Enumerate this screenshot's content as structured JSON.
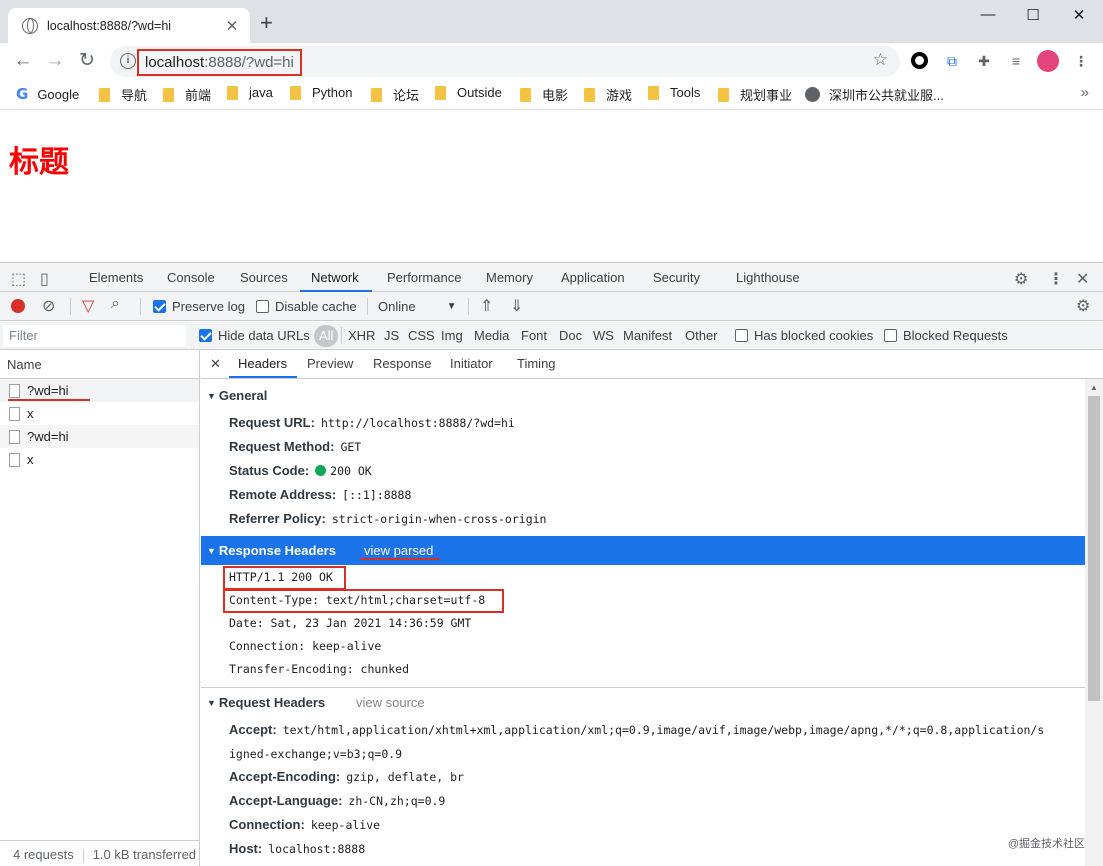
{
  "browser": {
    "tab_title": "localhost:8888/?wd=hi",
    "tab_close": "✕",
    "new_tab": "+",
    "window_controls": {
      "minimize": "—",
      "maximize": "☐",
      "close": "✕"
    },
    "nav": {
      "back": "←",
      "forward": "→",
      "reload": "↻"
    },
    "url_host": "localhost",
    "url_rest": ":8888/?wd=hi",
    "star_icon": "☆",
    "bookmarks": [
      {
        "label": "Google",
        "icon": "google-icon"
      },
      {
        "label": "导航",
        "icon": "folder-icon"
      },
      {
        "label": "前端",
        "icon": "folder-icon"
      },
      {
        "label": "java",
        "icon": "folder-icon"
      },
      {
        "label": "Python",
        "icon": "folder-icon"
      },
      {
        "label": "论坛",
        "icon": "folder-icon"
      },
      {
        "label": "Outside",
        "icon": "folder-icon"
      },
      {
        "label": "电影",
        "icon": "folder-icon"
      },
      {
        "label": "游戏",
        "icon": "folder-icon"
      },
      {
        "label": "Tools",
        "icon": "folder-icon"
      },
      {
        "label": "规划事业",
        "icon": "folder-icon"
      },
      {
        "label": "深圳市公共就业服...",
        "icon": "globe-icon"
      }
    ],
    "bookmarks_more": "»"
  },
  "page": {
    "heading": "标题"
  },
  "devtools": {
    "tabs": [
      "Elements",
      "Console",
      "Sources",
      "Network",
      "Performance",
      "Memory",
      "Application",
      "Security",
      "Lighthouse"
    ],
    "active_tab": "Network",
    "toolbar": {
      "preserve_log": "Preserve log",
      "disable_cache": "Disable cache",
      "throttle": "Online"
    },
    "filter": {
      "placeholder": "Filter",
      "hide_data_urls": "Hide data URLs",
      "all": "All",
      "types": [
        "XHR",
        "JS",
        "CSS",
        "Img",
        "Media",
        "Font",
        "Doc",
        "WS",
        "Manifest",
        "Other"
      ],
      "has_blocked_cookies": "Has blocked cookies",
      "blocked_requests": "Blocked Requests"
    },
    "requests": {
      "header": "Name",
      "rows": [
        "?wd=hi",
        "x",
        "?wd=hi",
        "x"
      ],
      "status_count": "4 requests",
      "status_transferred": "1.0 kB transferred"
    },
    "details": {
      "close": "✕",
      "tabs": [
        "Headers",
        "Preview",
        "Response",
        "Initiator",
        "Timing"
      ],
      "general": {
        "title": "General",
        "request_url_k": "Request URL:",
        "request_url_v": "http://localhost:8888/?wd=hi",
        "request_method_k": "Request Method:",
        "request_method_v": "GET",
        "status_code_k": "Status Code:",
        "status_code_v": "200 OK",
        "remote_address_k": "Remote Address:",
        "remote_address_v": "[::1]:8888",
        "referrer_policy_k": "Referrer Policy:",
        "referrer_policy_v": "strict-origin-when-cross-origin"
      },
      "response_headers": {
        "title": "Response Headers",
        "link": "view parsed",
        "lines": [
          "HTTP/1.1 200 OK",
          "Content-Type: text/html;charset=utf-8",
          "Date: Sat, 23 Jan 2021 14:36:59 GMT",
          "Connection: keep-alive",
          "Transfer-Encoding: chunked"
        ]
      },
      "request_headers": {
        "title": "Request Headers",
        "link": "view source",
        "accept_k": "Accept:",
        "accept_v1": "text/html,application/xhtml+xml,application/xml;q=0.9,image/avif,image/webp,image/apng,*/*;q=0.8,application/s",
        "accept_v2": "igned-exchange;v=b3;q=0.9",
        "accept_encoding_k": "Accept-Encoding:",
        "accept_encoding_v": "gzip, deflate, br",
        "accept_language_k": "Accept-Language:",
        "accept_language_v": "zh-CN,zh;q=0.9",
        "connection_k": "Connection:",
        "connection_v": "keep-alive",
        "host_k": "Host:",
        "host_v": "localhost:8888"
      }
    }
  },
  "watermark": "@掘金技术社区",
  "colors": {
    "accent": "#1a73e8",
    "highlight_box": "#d93025",
    "heading": "#ff0000",
    "status_ok": "#0ca75c"
  }
}
